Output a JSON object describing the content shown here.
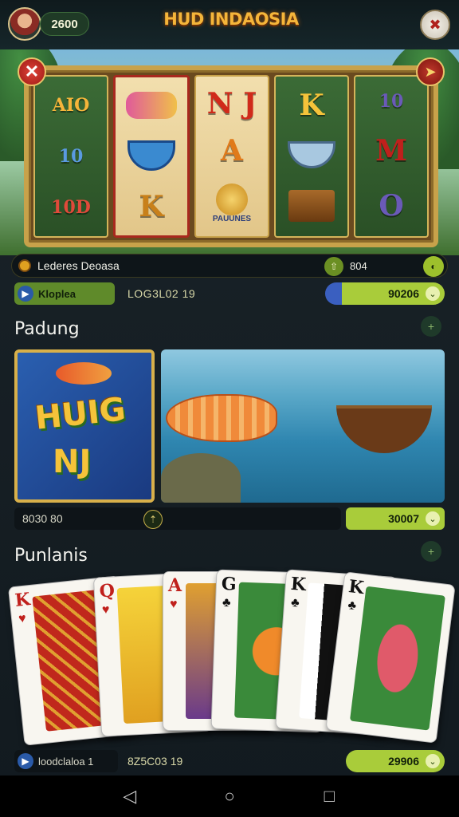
{
  "header": {
    "coins": "2600",
    "title": "HUD INDAOSIA"
  },
  "slot": {
    "reels": [
      [
        "AIO",
        "10",
        "10D"
      ],
      [
        "",
        "",
        "K"
      ],
      [
        "N J",
        "A",
        ""
      ],
      [
        "K",
        "",
        ""
      ],
      [
        "10",
        "M",
        "O"
      ]
    ],
    "reel_caption": "PAUUNES"
  },
  "leaders": {
    "label": "Lederes Deoasa",
    "count": "804"
  },
  "info_row": {
    "pill_label": "Kloplea",
    "text": "LOG3L02 19",
    "value": "90206"
  },
  "sections": {
    "first": "Padung",
    "second": "Punlanis"
  },
  "feature": {
    "hero_word1": "HUIG",
    "hero_word2": "NJ",
    "left_text": "8030 80",
    "value": "30007"
  },
  "cards": [
    {
      "rank": "K",
      "suit": "♥",
      "color": "red"
    },
    {
      "rank": "Q",
      "suit": "♥",
      "color": "red"
    },
    {
      "rank": "A",
      "suit": "♥",
      "color": "red"
    },
    {
      "rank": "G",
      "suit": "♣",
      "color": "black"
    },
    {
      "rank": "K",
      "suit": "♣",
      "color": "black"
    },
    {
      "rank": "K",
      "suit": "♣",
      "color": "black"
    }
  ],
  "bottom_row": {
    "pill_label": "loodclaloa 1",
    "text": "8Z5C03 19",
    "value": "29906"
  }
}
